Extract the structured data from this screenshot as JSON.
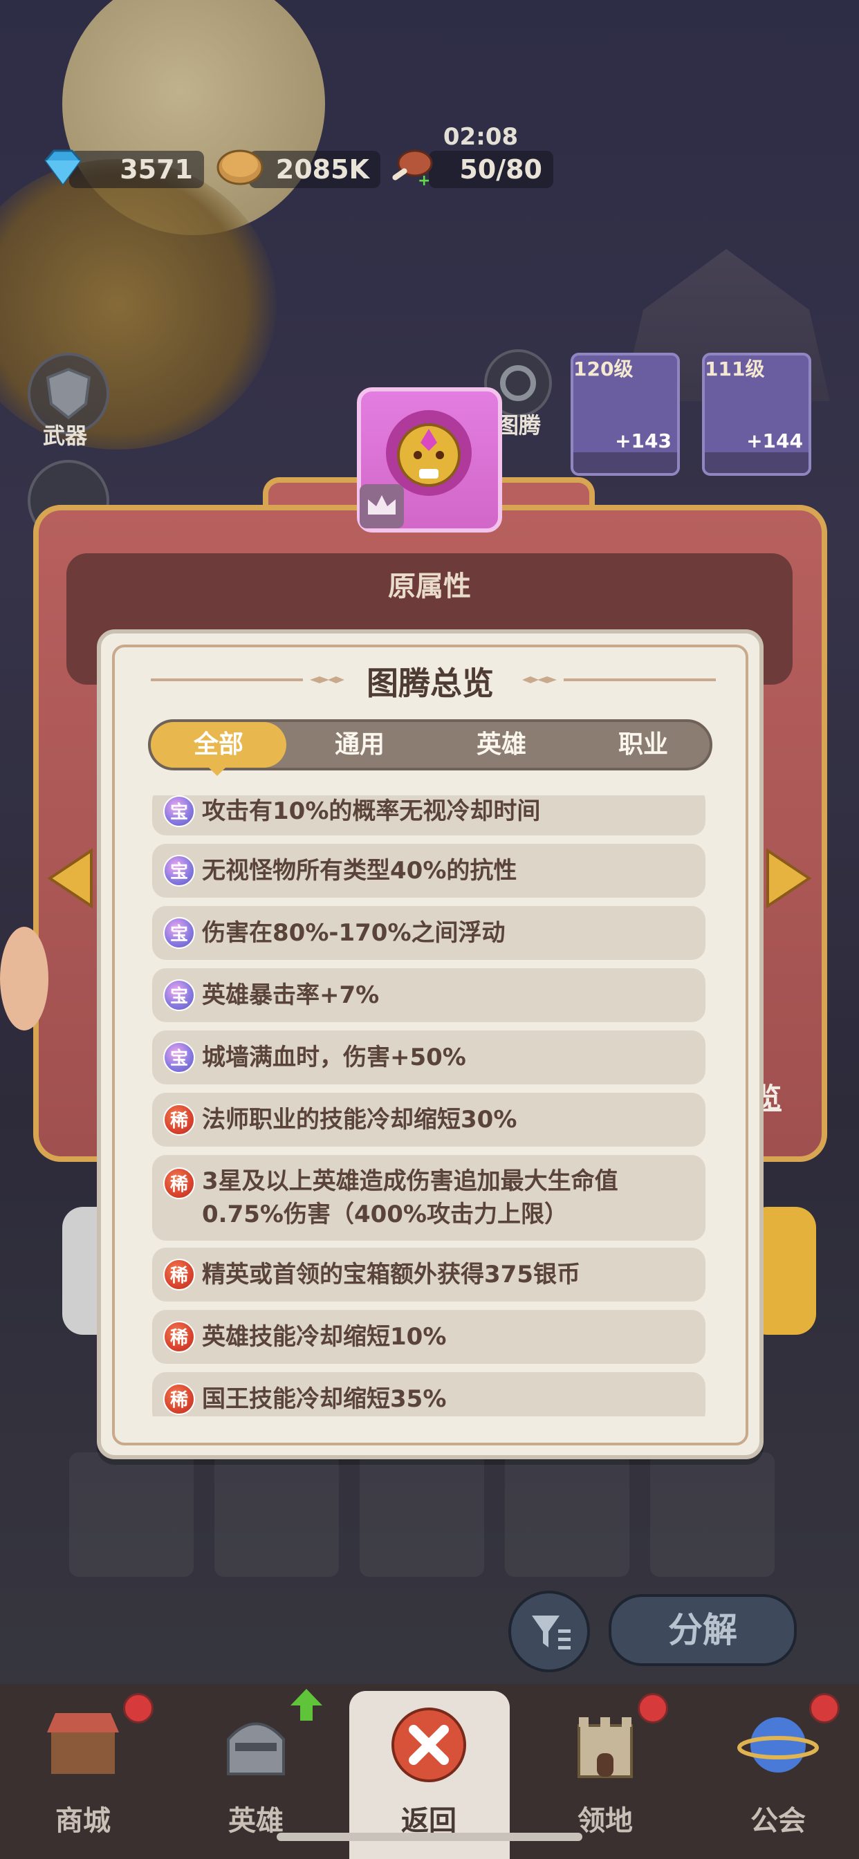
{
  "resources": {
    "gems": "3571",
    "coins": "2085K",
    "stamina": "50/80",
    "timer": "02:08"
  },
  "side_menu": {
    "weapon_label": "武器",
    "totem_label": "图腾"
  },
  "hero_cards": [
    {
      "level": "120级",
      "bonus": "+143"
    },
    {
      "level": "111级",
      "bonus": "+144"
    }
  ],
  "panel": {
    "original_attr_title": "原属性",
    "overview_link": "览"
  },
  "dialog": {
    "title": "图腾总览",
    "tabs": [
      "全部",
      "通用",
      "英雄",
      "职业"
    ],
    "active_tab": "全部",
    "items": [
      {
        "badge": "宝",
        "tier": "treasure",
        "text": "攻击有10%的概率无视冷却时间"
      },
      {
        "badge": "宝",
        "tier": "treasure",
        "text": "无视怪物所有类型40%的抗性"
      },
      {
        "badge": "宝",
        "tier": "treasure",
        "text": "伤害在80%-170%之间浮动"
      },
      {
        "badge": "宝",
        "tier": "treasure",
        "text": "英雄暴击率+7%"
      },
      {
        "badge": "宝",
        "tier": "treasure",
        "text": "城墙满血时，伤害+50%"
      },
      {
        "badge": "稀",
        "tier": "rare",
        "text": "法师职业的技能冷却缩短30%"
      },
      {
        "badge": "稀",
        "tier": "rare",
        "text": "3星及以上英雄造成伤害追加最大生命值0.75%伤害（400%攻击力上限）"
      },
      {
        "badge": "稀",
        "tier": "rare",
        "text": "精英或首领的宝箱额外获得375银币"
      },
      {
        "badge": "稀",
        "tier": "rare",
        "text": "英雄技能冷却缩短10%"
      },
      {
        "badge": "稀",
        "tier": "rare",
        "text": "国王技能冷却缩短35%"
      }
    ]
  },
  "actions": {
    "decompose_label": "分解"
  },
  "bottom_nav": [
    {
      "label": "商城",
      "icon": "shop-icon"
    },
    {
      "label": "英雄",
      "icon": "hero-helmet-icon"
    },
    {
      "label": "返回",
      "icon": "close-icon"
    },
    {
      "label": "领地",
      "icon": "castle-icon"
    },
    {
      "label": "公会",
      "icon": "planet-icon"
    }
  ],
  "colors": {
    "accent_gold": "#e8b84f",
    "panel_red": "#b7605e",
    "treasure_badge": "#8a7be0",
    "rare_badge": "#d8432d"
  }
}
